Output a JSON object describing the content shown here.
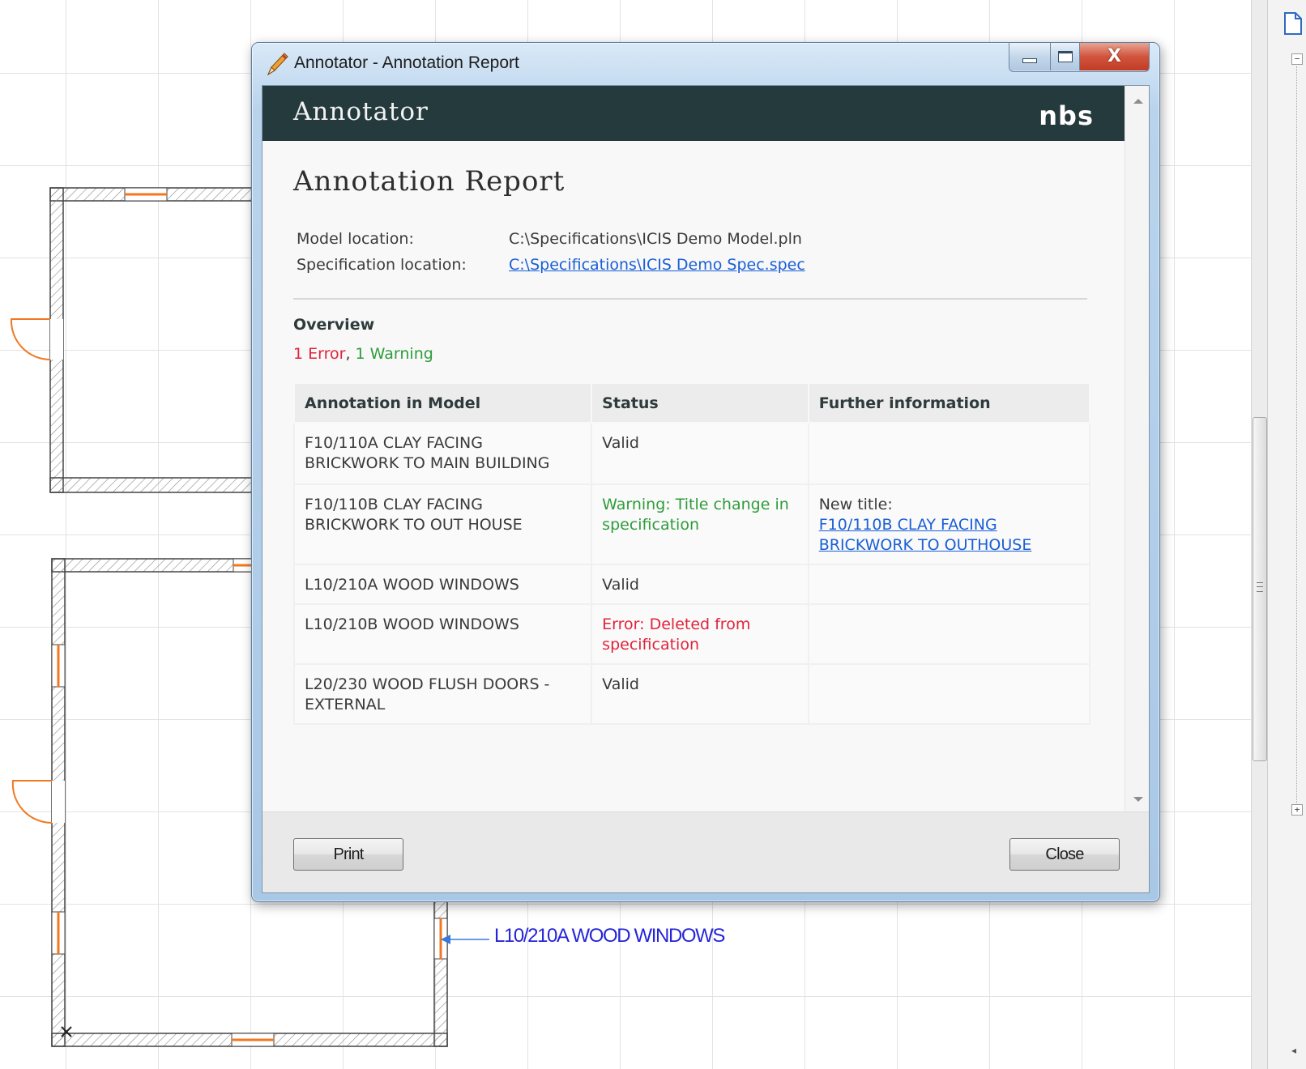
{
  "cad": {
    "annotation_label": "L10/210A WOOD WINDOWS"
  },
  "window": {
    "title": "Annotator - Annotation Report",
    "close_symbol": "X"
  },
  "header": {
    "app_name": "Annotator",
    "logo_text": "nbs"
  },
  "report": {
    "title": "Annotation Report",
    "model_location_label": "Model location:",
    "model_location_value": "C:\\Specifications\\ICIS Demo Model.pln",
    "spec_location_label": "Specification location:",
    "spec_location_value": "C:\\Specifications\\ICIS Demo Spec.spec",
    "overview_heading": "Overview",
    "overview_error": "1 Error",
    "overview_separator": ", ",
    "overview_warning": "1 Warning",
    "table": {
      "headers": [
        "Annotation in Model",
        "Status",
        "Further information"
      ],
      "rows": [
        {
          "annotation": "F10/110A CLAY FACING BRICKWORK TO MAIN BUILDING",
          "status": "Valid",
          "status_type": "valid",
          "info_label": "",
          "info_link": ""
        },
        {
          "annotation": "F10/110B CLAY FACING BRICKWORK TO OUT HOUSE",
          "status": "Warning: Title change in specification",
          "status_type": "warning",
          "info_label": "New title:",
          "info_link": "F10/110B CLAY FACING BRICKWORK TO OUTHOUSE"
        },
        {
          "annotation": "L10/210A WOOD WINDOWS",
          "status": "Valid",
          "status_type": "valid",
          "info_label": "",
          "info_link": ""
        },
        {
          "annotation": "L10/210B WOOD WINDOWS",
          "status": "Error: Deleted from specification",
          "status_type": "error",
          "info_label": "",
          "info_link": ""
        },
        {
          "annotation": "L20/230 WOOD FLUSH DOORS - EXTERNAL",
          "status": "Valid",
          "status_type": "valid",
          "info_label": "",
          "info_link": ""
        }
      ]
    }
  },
  "footer": {
    "print_label": "Print",
    "close_label": "Close"
  },
  "colors": {
    "header_bg": "#253a3c",
    "error": "#e0233a",
    "warning": "#2e9c3b",
    "link": "#1a5fd6",
    "cad_opening": "#f07820",
    "cad_label": "#2424d8"
  }
}
